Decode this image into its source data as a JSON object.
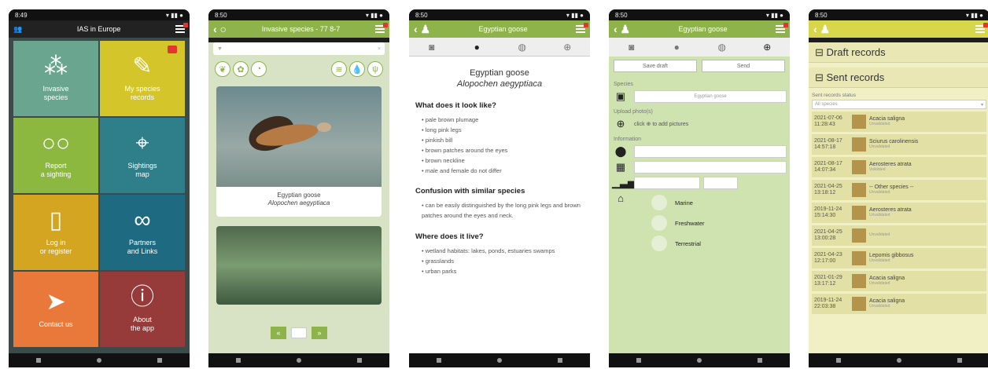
{
  "status_time": "8:49",
  "status_time_b": "8:50",
  "screen1": {
    "title": "IAS in Europe",
    "tiles": [
      {
        "label1": "Invasive",
        "label2": "species",
        "icon": "molecule-icon"
      },
      {
        "label1": "My species",
        "label2": "records",
        "icon": "clipboard-icon"
      },
      {
        "label1": "Report",
        "label2": "a sighting",
        "icon": "binoculars-icon"
      },
      {
        "label1": "Sightings",
        "label2": "map",
        "icon": "map-pin-icon"
      },
      {
        "label1": "Log in",
        "label2": "or register",
        "icon": "phone-icon"
      },
      {
        "label1": "Partners",
        "label2": "and Links",
        "icon": "link-icon"
      },
      {
        "label1": "Contact us",
        "label2": "",
        "icon": "paper-plane-icon"
      },
      {
        "label1": "About",
        "label2": "the app",
        "icon": "phone-info-icon"
      }
    ]
  },
  "screen2": {
    "title": "Invasive species",
    "count": "77 8-7",
    "card1_name": "Egyptian goose",
    "card1_latin": "Alopochen aegyptiaca",
    "pager_prev": "«",
    "pager_next": "»"
  },
  "screen3": {
    "title": "Egyptian goose",
    "common": "Egyptian goose",
    "latin": "Alopochen aegyptiaca",
    "h1": "What does it look like?",
    "look": [
      "pale brown plumage",
      "long pink legs",
      "pinkish bill",
      "brown patches around the eyes",
      "brown neckline",
      "male and female do not differ"
    ],
    "h2": "Confusion with similar species",
    "confusion": "can be easily distinguished by the long pink legs and brown patches around the eyes and neck.",
    "h3": "Where does it live?",
    "where": [
      "wetland habitats: lakes, ponds, estuaries swamps",
      "grasslands",
      "urban parks"
    ]
  },
  "screen4": {
    "title": "Egyptian goose",
    "save": "Save draft",
    "send": "Send",
    "species_lbl": "Species",
    "species_val": "Egyptian goose",
    "photos_lbl": "Upload photo(s)",
    "photos_val": "click ⊕ to add pictures",
    "info_lbl": "Information",
    "habitats": [
      "Marine",
      "Freshwater",
      "Terrestrial"
    ]
  },
  "screen5": {
    "draft": "Draft records",
    "sent": "Sent records",
    "filter_lbl": "Sent records status",
    "filter_val": "All species",
    "records": [
      {
        "date": "2021-07-06",
        "time": "11:28:43",
        "species": "Acacia saligna",
        "status": "Unvalidated"
      },
      {
        "date": "2021-08-17",
        "time": "14:57:18",
        "species": "Sciurus carolinensis",
        "status": "Unvalidated"
      },
      {
        "date": "2021-08-17",
        "time": "14:07:34",
        "species": "Aerosteres atrata",
        "status": "Validated"
      },
      {
        "date": "2021-04-25",
        "time": "13:18:12",
        "species": "-- Other species --",
        "status": "Unvalidated"
      },
      {
        "date": "2019-11-24",
        "time": "15:14:30",
        "species": "Aerosteres atrata",
        "status": "Unvalidated"
      },
      {
        "date": "2021-04-25",
        "time": "13:00:28",
        "species": "",
        "status": "Unvalidated"
      },
      {
        "date": "2021-04-23",
        "time": "12:17:00",
        "species": "Lepomis gibbosus",
        "status": "Unvalidated"
      },
      {
        "date": "2021-01-29",
        "time": "13:17:12",
        "species": "Acacia saligna",
        "status": "Unvalidated"
      },
      {
        "date": "2019-11-24",
        "time": "22:03:38",
        "species": "Acacia saligna",
        "status": "Unvalidated"
      }
    ]
  }
}
